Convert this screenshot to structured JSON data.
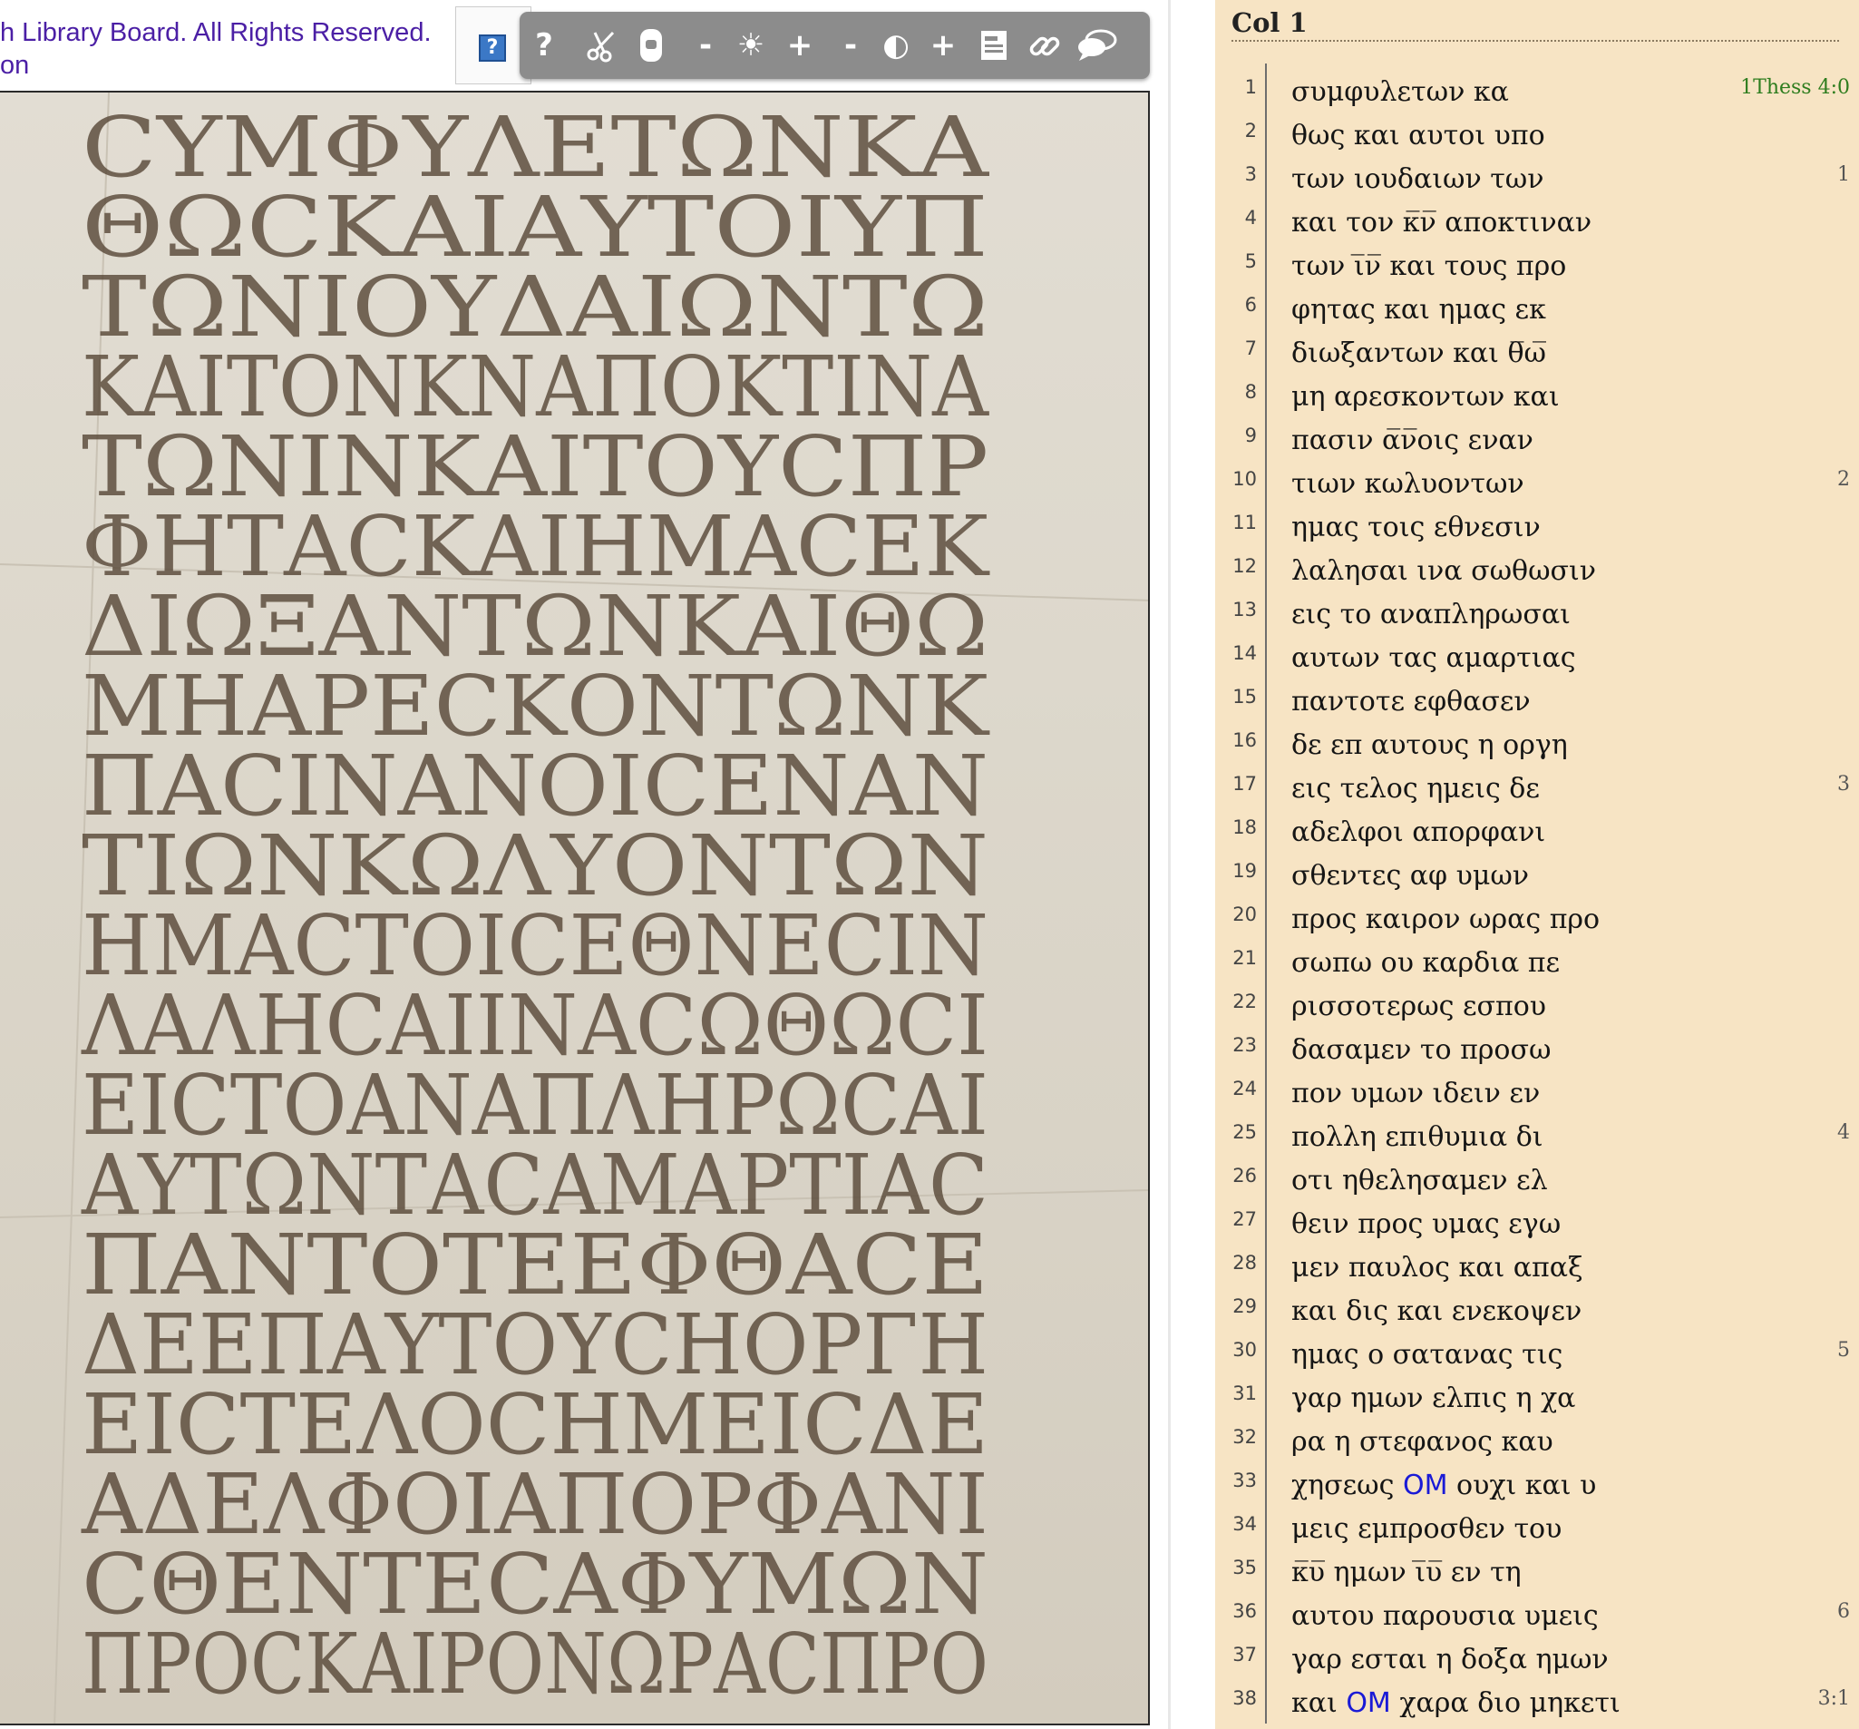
{
  "viewer": {
    "copyright_line1": "h Library Board. All Rights Reserved.",
    "copyright_line2": "on",
    "help_icon": "?",
    "toolbar": [
      {
        "name": "help-icon",
        "glyph": "?"
      },
      {
        "name": "scissors-icon",
        "glyph": "✂"
      },
      {
        "name": "lock-icon",
        "glyph": ""
      },
      {
        "name": "brightness-decrease-icon",
        "glyph": "-"
      },
      {
        "name": "brightness-icon",
        "glyph": "☀"
      },
      {
        "name": "brightness-increase-icon",
        "glyph": "+"
      },
      {
        "name": "contrast-decrease-icon",
        "glyph": "-"
      },
      {
        "name": "contrast-icon",
        "glyph": "◐"
      },
      {
        "name": "contrast-increase-icon",
        "glyph": "+"
      },
      {
        "name": "page-layout-icon",
        "glyph": ""
      },
      {
        "name": "link-icon",
        "glyph": ""
      },
      {
        "name": "comment-icon",
        "glyph": ""
      }
    ],
    "manuscript_lines": [
      "ϹΥΜΦΥΛΕΤΩΝΚΑ",
      "ΘΩϹΚΑΙΑΥΤΟΙΥΠ",
      "ΤΩΝΙΟΥΔΑΙΩΝΤΩ",
      "ΚΑΙΤΟΝΚΝΑΠΟΚΤΙΝΑ",
      "ΤΩΝΙΝΚΑΙΤΟΥϹΠΡ",
      "ΦΗΤΑϹΚΑΙΗΜΑϹΕΚ",
      "ΔΙΩΞΑΝΤΩΝΚΑΙΘΩ",
      "ΜΗΑΡΕϹΚΟΝΤΩΝΚ",
      "ΠΑϹΙΝΑΝΟΙϹΕΝΑΝ",
      "ΤΙΩΝΚΩΛΥΟΝΤΩΝ",
      "ΗΜΑϹΤΟΙϹΕΘΝΕϹΙΝ",
      "ΛΑΛΗϹΑΙΙΝΑϹΩΘΩϹΙ",
      "ΕΙϹΤΟΑΝΑΠΛΗΡΩϹΑΙ",
      "ΑΥΤΩΝΤΑϹΑΜΑΡΤΙΑϹ",
      "ΠΑΝΤΟΤΕΕΦΘΑϹΕ",
      "ΔΕΕΠΑΥΤΟΥϹΗΟΡΓΗ",
      "ΕΙϹΤΕΛΟϹΗΜΕΙϹΔΕ",
      "ΑΔΕΛΦΟΙΑΠΟΡΦΑΝΙ",
      "ϹΘΕΝΤΕϹΑΦΥΜΩΝ",
      "ΠΡΟϹΚΑΙΡΟΝΩΡΑϹΠΡΟ"
    ]
  },
  "transcription": {
    "column_title": "Col 1",
    "lines": [
      {
        "num": "1",
        "parts": [
          {
            "t": "συμφυλετων κα"
          }
        ],
        "marker": "1Thess 4:0",
        "marker_color": "#2e7d1e"
      },
      {
        "num": "2",
        "parts": [
          {
            "t": "θως και αυτοι υπο"
          }
        ],
        "marker": ""
      },
      {
        "num": "3",
        "parts": [
          {
            "t": "των ιουδαιων των"
          }
        ],
        "marker": "1"
      },
      {
        "num": "4",
        "parts": [
          {
            "t": "και τον κ̅ν̅ αποκτιναν"
          }
        ],
        "marker": ""
      },
      {
        "num": "5",
        "parts": [
          {
            "t": "των ι̅ν̅ και τους προ"
          }
        ],
        "marker": ""
      },
      {
        "num": "6",
        "parts": [
          {
            "t": "φητας και ημας εκ"
          }
        ],
        "marker": ""
      },
      {
        "num": "7",
        "parts": [
          {
            "t": "διωξαντων και θ̅ω̅"
          }
        ],
        "marker": ""
      },
      {
        "num": "8",
        "parts": [
          {
            "t": "μη αρεσκοντων και"
          }
        ],
        "marker": ""
      },
      {
        "num": "9",
        "parts": [
          {
            "t": "πασιν α̅ν̅οις εναν"
          }
        ],
        "marker": ""
      },
      {
        "num": "10",
        "parts": [
          {
            "t": "τιων κωλυοντων"
          }
        ],
        "marker": "2"
      },
      {
        "num": "11",
        "parts": [
          {
            "t": "ημας τοις εθνεσιν"
          }
        ],
        "marker": ""
      },
      {
        "num": "12",
        "parts": [
          {
            "t": "λαλησαι ινα σωθωσιν"
          }
        ],
        "marker": ""
      },
      {
        "num": "13",
        "parts": [
          {
            "t": "εις το αναπληρωσαι"
          }
        ],
        "marker": ""
      },
      {
        "num": "14",
        "parts": [
          {
            "t": "αυτων τας αμαρτιας"
          }
        ],
        "marker": ""
      },
      {
        "num": "15",
        "parts": [
          {
            "t": "παντοτε εφθασεν"
          }
        ],
        "marker": ""
      },
      {
        "num": "16",
        "parts": [
          {
            "t": "δε επ αυτους η οργη"
          }
        ],
        "marker": ""
      },
      {
        "num": "17",
        "parts": [
          {
            "t": "εις τελος ημεις δε"
          }
        ],
        "marker": "3"
      },
      {
        "num": "18",
        "parts": [
          {
            "t": "αδελφοι απορφανι"
          }
        ],
        "marker": ""
      },
      {
        "num": "19",
        "parts": [
          {
            "t": "σθεντες αφ υμων"
          }
        ],
        "marker": ""
      },
      {
        "num": "20",
        "parts": [
          {
            "t": "προς καιρον ωρας προ"
          }
        ],
        "marker": ""
      },
      {
        "num": "21",
        "parts": [
          {
            "t": "σωπω ου καρδια πε"
          }
        ],
        "marker": ""
      },
      {
        "num": "22",
        "parts": [
          {
            "t": "ρισσοτερως εσπου"
          }
        ],
        "marker": ""
      },
      {
        "num": "23",
        "parts": [
          {
            "t": "δασαμεν το προσω"
          }
        ],
        "marker": ""
      },
      {
        "num": "24",
        "parts": [
          {
            "t": "πον υμων ιδειν εν"
          }
        ],
        "marker": ""
      },
      {
        "num": "25",
        "parts": [
          {
            "t": "πολλη επιθυμια δι"
          }
        ],
        "marker": "4"
      },
      {
        "num": "26",
        "parts": [
          {
            "t": "οτι ηθελησαμεν ελ"
          }
        ],
        "marker": ""
      },
      {
        "num": "27",
        "parts": [
          {
            "t": "θειν προς υμας εγω"
          }
        ],
        "marker": ""
      },
      {
        "num": "28",
        "parts": [
          {
            "t": "μεν παυλος και απαξ"
          }
        ],
        "marker": ""
      },
      {
        "num": "29",
        "parts": [
          {
            "t": "και δις και ενεκοψεν"
          }
        ],
        "marker": ""
      },
      {
        "num": "30",
        "parts": [
          {
            "t": "ημας ο σατανας τις"
          }
        ],
        "marker": "5"
      },
      {
        "num": "31",
        "parts": [
          {
            "t": "γαρ ημων ελπις η χα"
          }
        ],
        "marker": ""
      },
      {
        "num": "32",
        "parts": [
          {
            "t": "ρα η στεφανος καυ"
          }
        ],
        "marker": ""
      },
      {
        "num": "33",
        "parts": [
          {
            "t": "χησεως "
          },
          {
            "t": "OM",
            "om": true
          },
          {
            "t": " ουχι και υ"
          }
        ],
        "marker": ""
      },
      {
        "num": "34",
        "parts": [
          {
            "t": "μεις εμπροσθεν του"
          }
        ],
        "marker": ""
      },
      {
        "num": "35",
        "parts": [
          {
            "t": "κ̅υ̅ ημων ι̅υ̅ εν τη"
          }
        ],
        "marker": ""
      },
      {
        "num": "36",
        "parts": [
          {
            "t": "αυτου παρουσια υμεις"
          }
        ],
        "marker": "6"
      },
      {
        "num": "37",
        "parts": [
          {
            "t": "γαρ εσται η δοξα ημων"
          }
        ],
        "marker": ""
      },
      {
        "num": "38",
        "parts": [
          {
            "t": "και "
          },
          {
            "t": "OM",
            "om": true
          },
          {
            "t": " χαρα διο μηκετι"
          }
        ],
        "marker": "3:1"
      }
    ]
  }
}
